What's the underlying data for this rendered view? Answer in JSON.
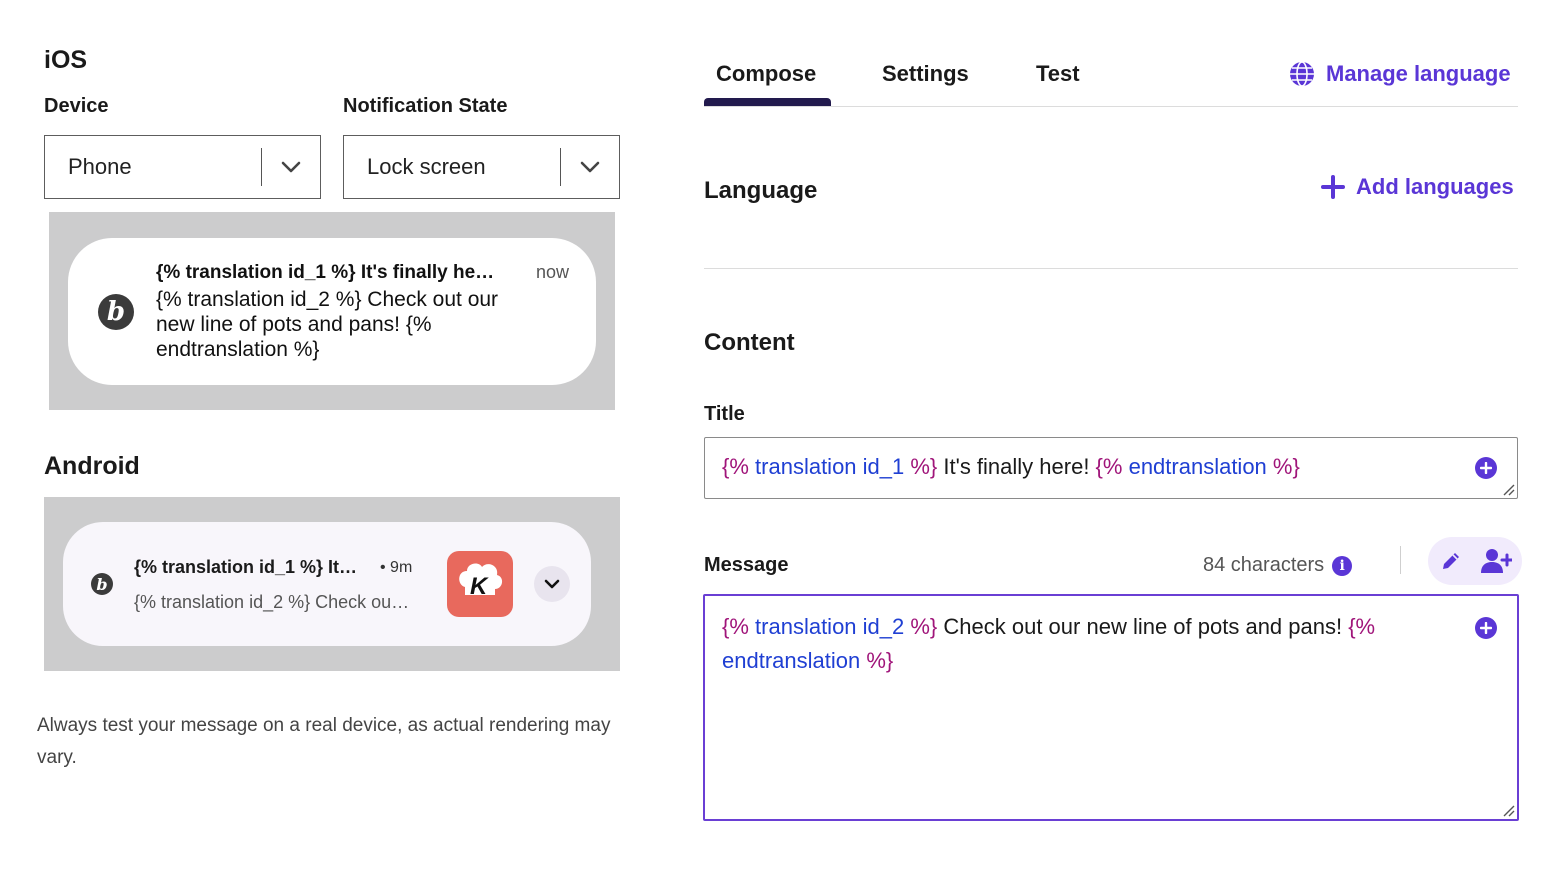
{
  "ios": {
    "heading": "iOS",
    "device_label": "Device",
    "device_value": "Phone",
    "state_label": "Notification State",
    "state_value": "Lock screen",
    "notification": {
      "title": "{% translation id_1 %} It's finally he…",
      "time": "now",
      "body": "{% translation id_2 %} Check out our new line of pots and pans! {% endtranslation %}",
      "logo_letter": "b"
    }
  },
  "android": {
    "heading": "Android",
    "notification": {
      "title": "{% translation id_1 %} It…",
      "time": "• 9m",
      "body": "{% translation id_2 %} Check ou…",
      "logo_letter": "b",
      "app_letter": "K"
    }
  },
  "footnote": "Always test your message on a real device, as actual rendering may vary.",
  "tabs": [
    {
      "label": "Compose",
      "active": true
    },
    {
      "label": "Settings",
      "active": false
    },
    {
      "label": "Test",
      "active": false
    }
  ],
  "manage_language": "Manage language",
  "language_heading": "Language",
  "add_languages": "Add languages",
  "content_heading": "Content",
  "title_field": {
    "label": "Title",
    "tokens": [
      {
        "t": "{%",
        "c": "brace"
      },
      {
        "t": " translation id_1 ",
        "c": "kw"
      },
      {
        "t": "%}",
        "c": "brace"
      },
      {
        "t": " It's finally here! ",
        "c": "text"
      },
      {
        "t": "{%",
        "c": "brace"
      },
      {
        "t": " endtranslation ",
        "c": "kw"
      },
      {
        "t": "%}",
        "c": "brace"
      }
    ]
  },
  "message_field": {
    "label": "Message",
    "char_count": "84 characters",
    "line1": [
      {
        "t": "{%",
        "c": "brace"
      },
      {
        "t": " translation id_2 ",
        "c": "kw"
      },
      {
        "t": "%}",
        "c": "brace"
      },
      {
        "t": " Check out our new line of pots and pans! ",
        "c": "text"
      },
      {
        "t": "{%",
        "c": "brace"
      }
    ],
    "line2": [
      {
        "t": "endtranslation ",
        "c": "kw"
      },
      {
        "t": "%}",
        "c": "brace"
      }
    ]
  },
  "colors": {
    "accent": "#5a36d6",
    "brace": "#a0157a",
    "keyword": "#1f3fd3",
    "preview_bg": "#cccccd"
  }
}
